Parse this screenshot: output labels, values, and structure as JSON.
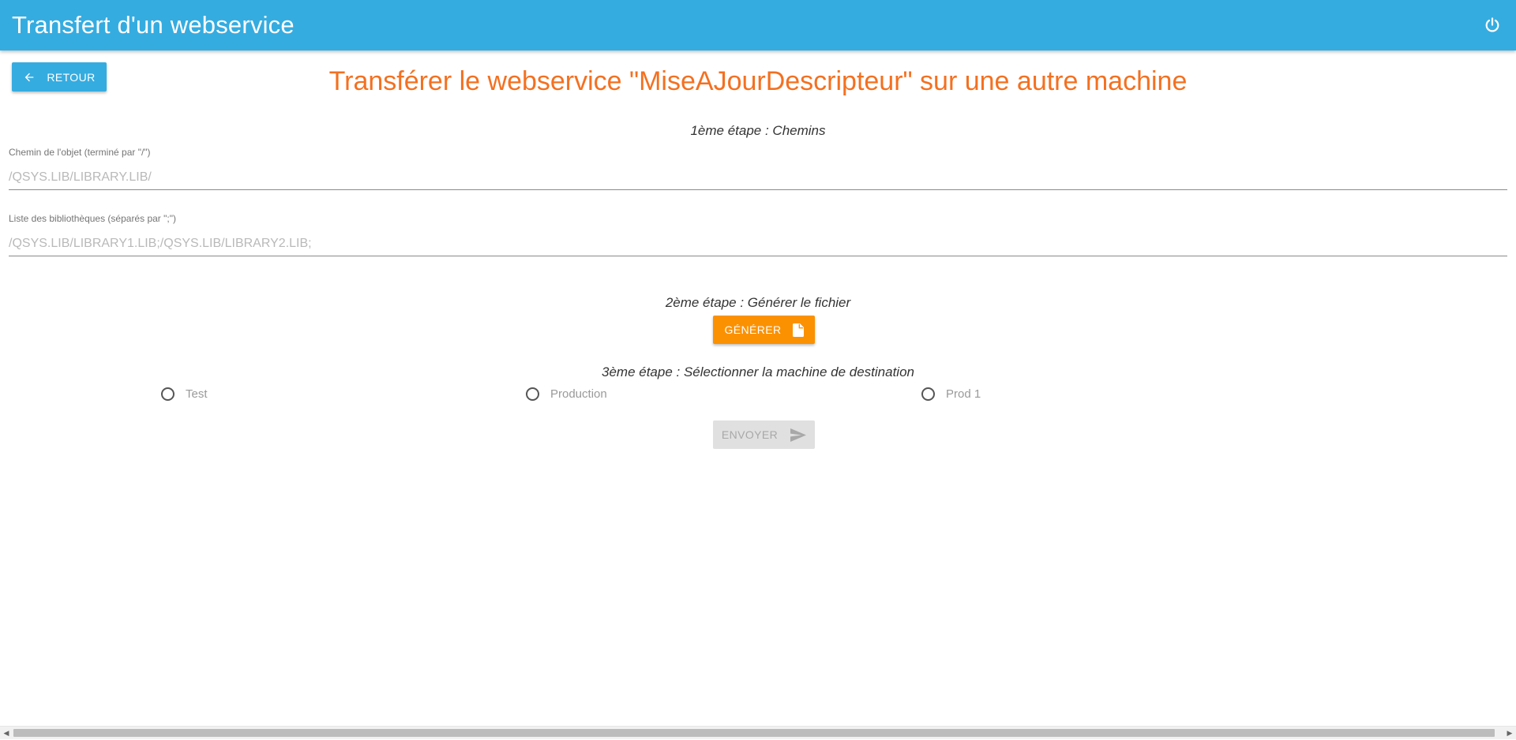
{
  "header": {
    "title": "Transfert d'un webservice",
    "power_icon": "power-icon"
  },
  "back_button": {
    "label": "Retour",
    "icon": "arrow-left-icon"
  },
  "page_title": "Transférer le webservice \"MiseAJourDescripteur\" sur une autre machine",
  "step1": {
    "title": "1ème étape : Chemins",
    "object_path": {
      "label": "Chemin de l'objet (terminé par \"/\")",
      "placeholder": "/QSYS.LIB/LIBRARY.LIB/",
      "value": ""
    },
    "libraries": {
      "label": "Liste des bibliothèques (séparés par \";\")",
      "placeholder": "/QSYS.LIB/LIBRARY1.LIB;/QSYS.LIB/LIBRARY2.LIB;",
      "value": ""
    }
  },
  "step2": {
    "title": "2ème étape : Générer le fichier",
    "generate_label": "Générer",
    "generate_icon": "file-icon"
  },
  "step3": {
    "title": "3ème étape : Sélectionner la machine de destination",
    "machines": [
      "Test",
      "Production",
      "Prod 1"
    ],
    "selected": null
  },
  "send_button": {
    "label": "Envoyer",
    "icon": "send-icon",
    "disabled": true
  },
  "colors": {
    "primary": "#35ace0",
    "accent_title": "#f47020",
    "generate": "#fb9100",
    "disabled": "#e0e0e0"
  }
}
